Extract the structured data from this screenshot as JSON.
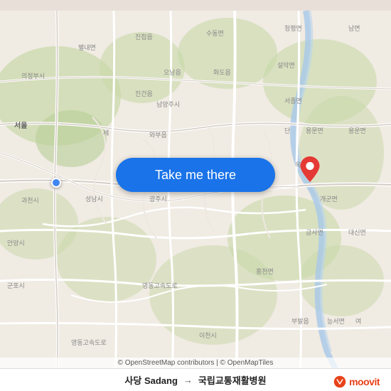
{
  "map": {
    "background_color": "#e8e0d8",
    "center_lat": 37.5,
    "center_lng": 127.3
  },
  "button": {
    "label": "Take me there"
  },
  "attribution": {
    "text": "© OpenStreetMap contributors | © OpenMapTiles"
  },
  "route": {
    "from": "사당 Sadang",
    "arrow": "→",
    "to": "국립교통재활병원"
  },
  "logo": {
    "text": "moovit"
  }
}
